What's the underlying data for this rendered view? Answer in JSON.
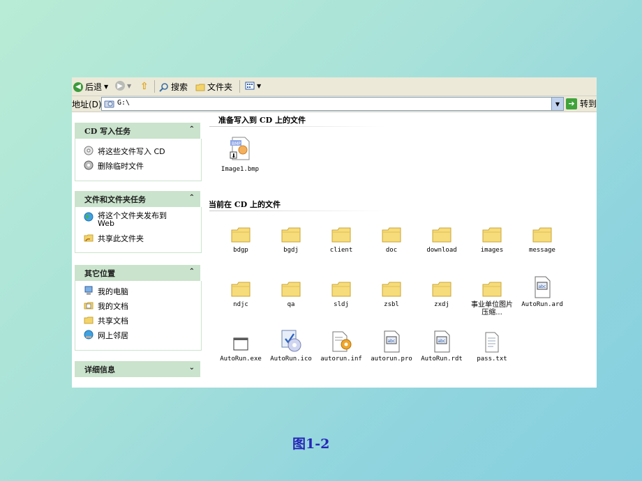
{
  "toolbar": {
    "back_label": "后退",
    "search_label": "搜索",
    "folders_label": "文件夹"
  },
  "address": {
    "label": "地址(D)",
    "value": "G:\\",
    "go_label": "转到"
  },
  "panels": {
    "cd_tasks": {
      "title": "CD 写入任务",
      "items": [
        "将这些文件写入 CD",
        "删除临时文件"
      ]
    },
    "file_tasks": {
      "title": "文件和文件夹任务",
      "items": [
        "将这个文件夹发布到\nWeb",
        "共享此文件夹"
      ]
    },
    "other_places": {
      "title": "其它位置",
      "items": [
        "我的电脑",
        "我的文档",
        "共享文档",
        "网上邻居"
      ]
    },
    "details": {
      "title": "详细信息"
    }
  },
  "sections": {
    "ready": "准备写入到 CD 上的文件",
    "current": "当前在 CD 上的文件"
  },
  "ready_files": [
    {
      "name": "Image1.bmp",
      "icon": "bmp-file-icon"
    }
  ],
  "current_files": [
    {
      "name": "bdgp",
      "icon": "folder-icon"
    },
    {
      "name": "bgdj",
      "icon": "folder-icon"
    },
    {
      "name": "client",
      "icon": "folder-icon"
    },
    {
      "name": "doc",
      "icon": "folder-icon"
    },
    {
      "name": "download",
      "icon": "folder-icon"
    },
    {
      "name": "images",
      "icon": "folder-icon"
    },
    {
      "name": "message",
      "icon": "folder-icon"
    },
    {
      "name": "ndjc",
      "icon": "folder-icon"
    },
    {
      "name": "qa",
      "icon": "folder-icon"
    },
    {
      "name": "sldj",
      "icon": "folder-icon"
    },
    {
      "name": "zsbl",
      "icon": "folder-icon"
    },
    {
      "name": "zxdj",
      "icon": "folder-icon"
    },
    {
      "name": "事业单位图片压缩...",
      "icon": "folder-icon"
    },
    {
      "name": "AutoRun.ard",
      "icon": "doc-file-icon"
    },
    {
      "name": "AutoRun.exe",
      "icon": "exe-file-icon"
    },
    {
      "name": "AutoRun.ico",
      "icon": "ico-file-icon"
    },
    {
      "name": "autorun.inf",
      "icon": "inf-file-icon"
    },
    {
      "name": "autorun.pro",
      "icon": "doc-file-icon"
    },
    {
      "name": "AutoRun.rdt",
      "icon": "doc-file-icon"
    },
    {
      "name": "pass.txt",
      "icon": "txt-file-icon"
    }
  ],
  "caption": "图1-2"
}
